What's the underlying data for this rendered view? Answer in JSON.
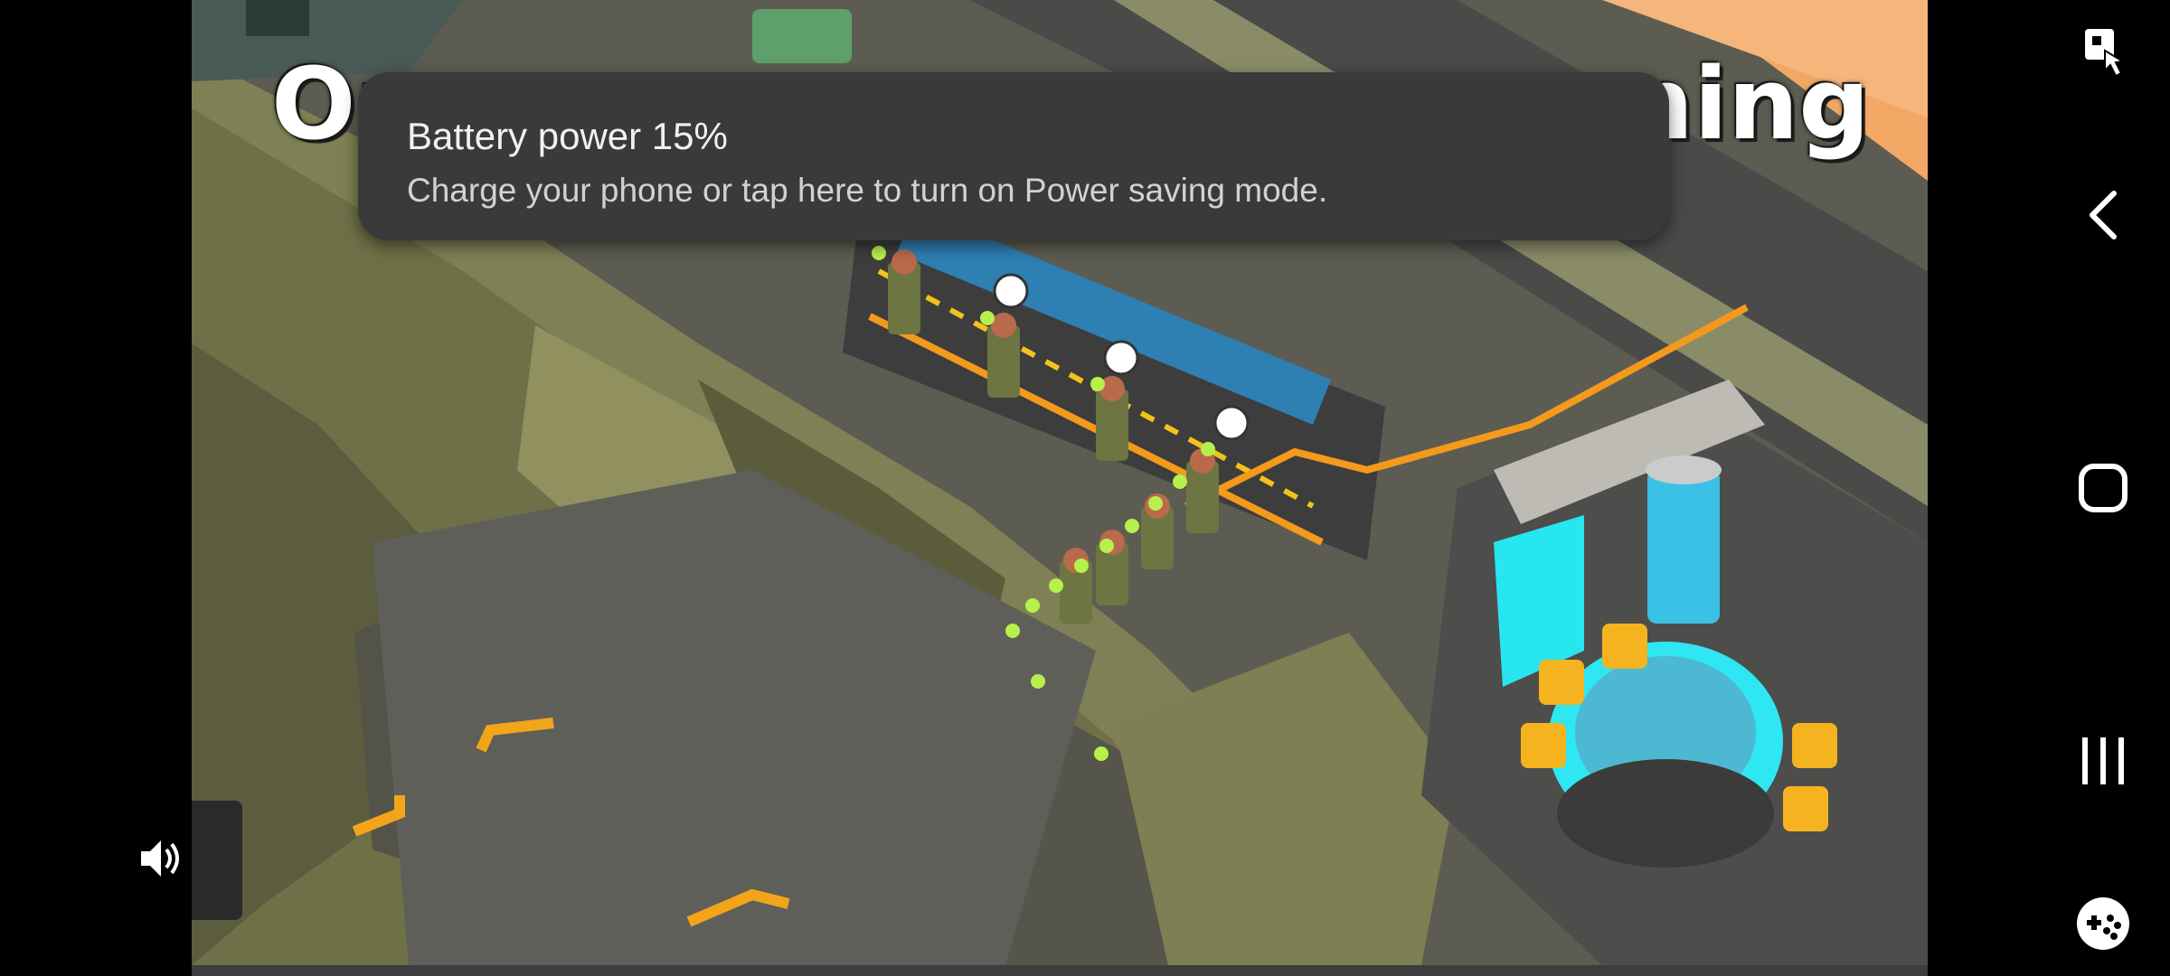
{
  "video": {
    "overlay_title_left": "Or",
    "overlay_title_right": "ning"
  },
  "notification": {
    "title": "Battery power 15%",
    "body": "Charge your phone or tap here to turn on Power saving mode."
  },
  "controls": {
    "volume_icon": "volume-icon"
  },
  "nav_bar": {
    "items": [
      {
        "name": "pin-icon"
      },
      {
        "name": "back-icon"
      },
      {
        "name": "home-icon"
      },
      {
        "name": "recents-icon"
      },
      {
        "name": "game-controller-icon"
      }
    ]
  },
  "colors": {
    "toast_background": "#3a3a3a",
    "accent_orange": "#f39a1c",
    "wall_olive": "#8b8c5c",
    "floor_gray": "#5b5a4f",
    "neon_cyan": "#25e3ef",
    "dot_green": "#b7f04a"
  }
}
